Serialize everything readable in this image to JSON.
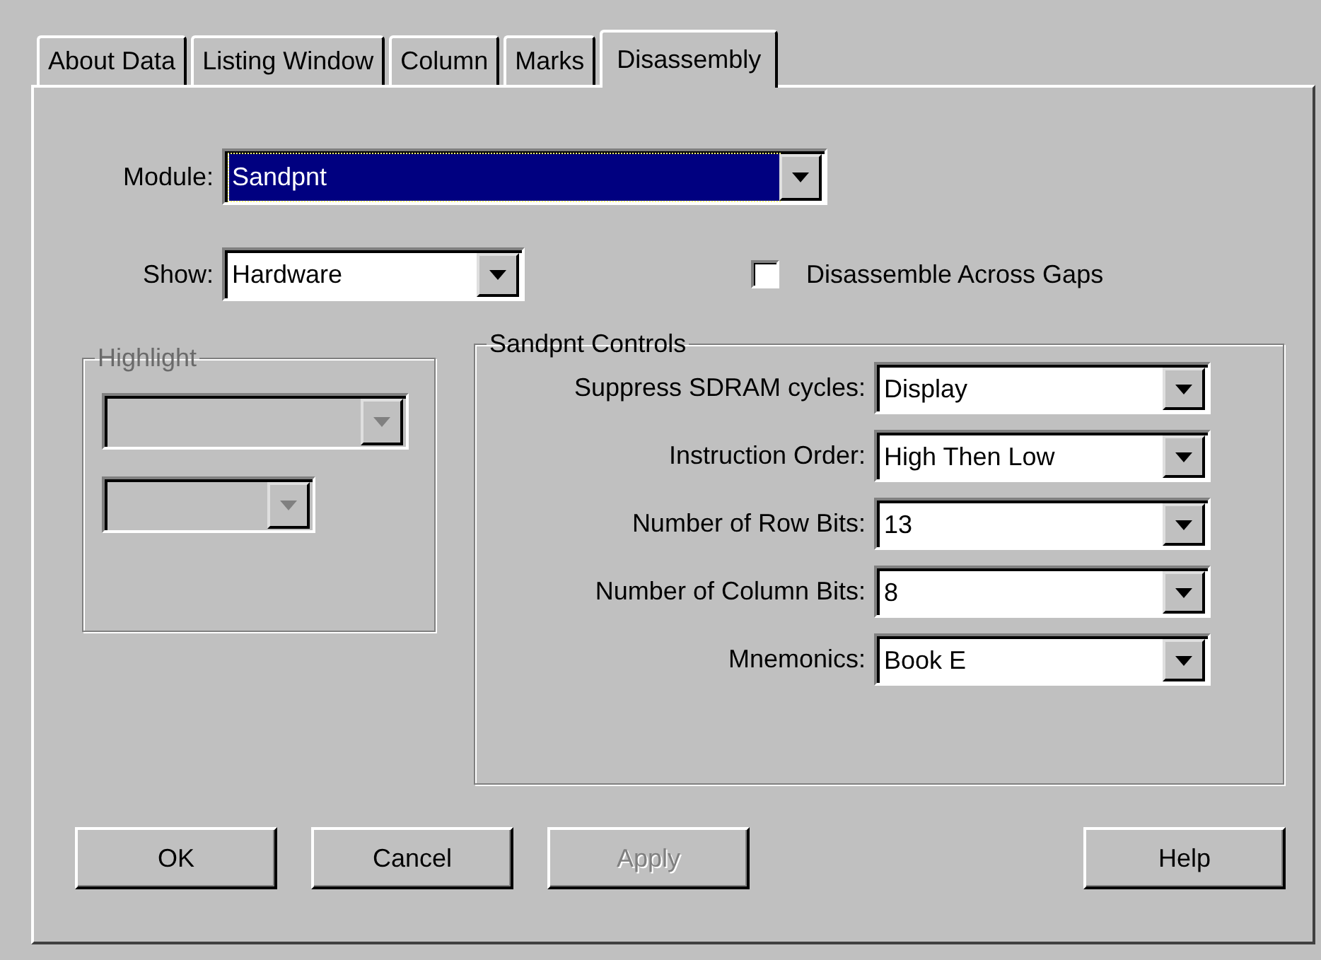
{
  "tabs": [
    {
      "label": "About Data",
      "selected": false
    },
    {
      "label": "Listing Window",
      "selected": false
    },
    {
      "label": "Column",
      "selected": false
    },
    {
      "label": "Marks",
      "selected": false
    },
    {
      "label": "Disassembly",
      "selected": true
    }
  ],
  "module": {
    "label": "Module:",
    "value": "Sandpnt",
    "focused": true
  },
  "show": {
    "label": "Show:",
    "value": "Hardware"
  },
  "disassemble_across_gaps": {
    "label": "Disassemble Across Gaps",
    "checked": false
  },
  "highlight": {
    "title": "Highlight",
    "disabled": true
  },
  "controls": {
    "title": "Sandpnt Controls",
    "rows": [
      {
        "label": "Suppress SDRAM cycles:",
        "value": "Display"
      },
      {
        "label": "Instruction Order:",
        "value": "High Then Low"
      },
      {
        "label": "Number of Row Bits:",
        "value": "13"
      },
      {
        "label": "Number of Column Bits:",
        "value": "8"
      },
      {
        "label": "Mnemonics:",
        "value": "Book E"
      }
    ]
  },
  "buttons": [
    {
      "label": "OK",
      "disabled": false
    },
    {
      "label": "Cancel",
      "disabled": false
    },
    {
      "label": "Apply",
      "disabled": true
    },
    {
      "label": "Help",
      "disabled": false
    }
  ]
}
